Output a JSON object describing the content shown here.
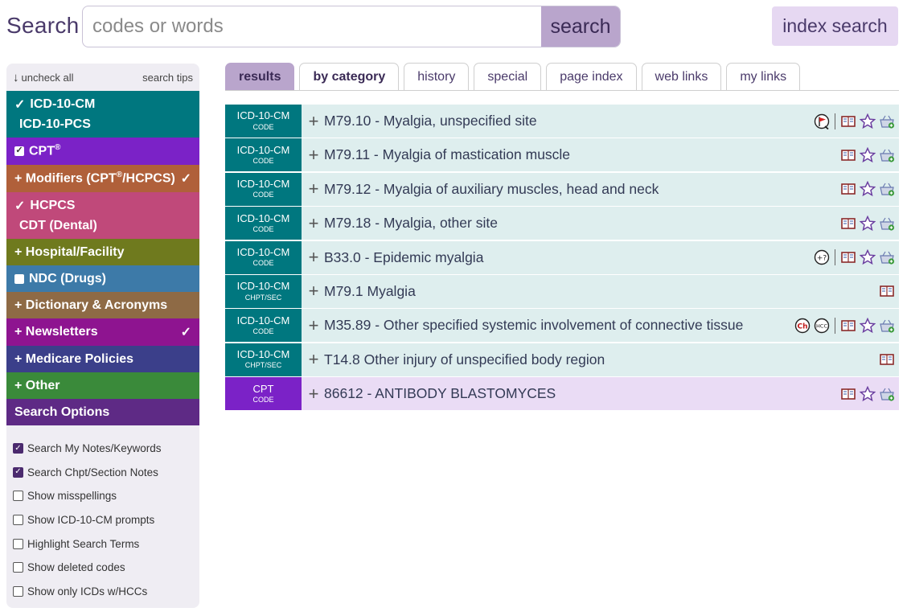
{
  "search": {
    "label": "Search",
    "placeholder": "codes or words",
    "value": "",
    "button": "search",
    "index_button": "index search"
  },
  "sidebar": {
    "uncheck_all": "uncheck all",
    "search_tips": "search tips",
    "categories": {
      "icd10cm": {
        "label": "ICD-10-CM",
        "checked": true,
        "color": "#00777f"
      },
      "icd10pcs": {
        "label": "ICD-10-PCS",
        "checked": false
      },
      "cpt": {
        "label": "CPT",
        "sup": "®",
        "checked": true,
        "color": "#7b22c7"
      },
      "modifiers": {
        "label": "+ Modifiers (CPT",
        "sup": "®",
        "label_tail": "/HCPCS)",
        "check": "✓",
        "color": "#b0603a"
      },
      "hcpcs": {
        "label": "HCPCS",
        "checked": true,
        "color": "#c0497a"
      },
      "cdt": {
        "label": "CDT (Dental)",
        "checked": false
      },
      "hospital": {
        "label": "+ Hospital/Facility",
        "color": "#6f7a1e"
      },
      "ndc": {
        "label": "NDC (Drugs)",
        "checked": false,
        "color": "#3d7aa8"
      },
      "dictionary": {
        "label": "+ Dictionary & Acronyms",
        "color": "#8e6a45"
      },
      "newsletters": {
        "label": "+ Newsletters",
        "check": "✓",
        "color": "#8e1490"
      },
      "medicare": {
        "label": "+ Medicare Policies",
        "color": "#3b3f8a"
      },
      "other": {
        "label": "+ Other",
        "color": "#3a8a3a"
      },
      "search_options": {
        "label": "Search Options",
        "color": "#5e2a85"
      }
    },
    "options": [
      {
        "label": "Search My Notes/Keywords",
        "checked": true
      },
      {
        "label": "Search Chpt/Section Notes",
        "checked": true
      },
      {
        "label": "Show misspellings",
        "checked": false
      },
      {
        "label": "Show ICD-10-CM prompts",
        "checked": false
      },
      {
        "label": "Highlight Search Terms",
        "checked": false
      },
      {
        "label": "Show deleted codes",
        "checked": false
      },
      {
        "label": "Show only ICDs w/HCCs",
        "checked": false
      }
    ]
  },
  "tabs": [
    "results",
    "by category",
    "history",
    "special",
    "page index",
    "web links",
    "my links"
  ],
  "results": [
    {
      "system": "ICD-10-CM",
      "kind": "CODE",
      "text": "M79.10 - Myalgia, unspecified site",
      "icons": [
        "flag-icon",
        "sep",
        "book-icon",
        "star-icon",
        "basket-icon"
      ]
    },
    {
      "system": "ICD-10-CM",
      "kind": "CODE",
      "text": "M79.11 - Myalgia of mastication muscle",
      "icons": [
        "book-icon",
        "star-icon",
        "basket-icon"
      ]
    },
    {
      "system": "ICD-10-CM",
      "kind": "CODE",
      "text": "M79.12 - Myalgia of auxiliary muscles, head and neck",
      "icons": [
        "book-icon",
        "star-icon",
        "basket-icon"
      ]
    },
    {
      "system": "ICD-10-CM",
      "kind": "CODE",
      "text": "M79.18 - Myalgia, other site",
      "icons": [
        "book-icon",
        "star-icon",
        "basket-icon"
      ]
    },
    {
      "system": "ICD-10-CM",
      "kind": "CODE",
      "text": "B33.0 - Epidemic myalgia",
      "icons": [
        "plus-question-icon",
        "sep",
        "book-icon",
        "star-icon",
        "basket-icon"
      ]
    },
    {
      "system": "ICD-10-CM",
      "kind": "CHPT/SEC",
      "text": "M79.1 Myalgia",
      "icons": [
        "book-icon"
      ]
    },
    {
      "system": "ICD-10-CM",
      "kind": "CODE",
      "text": "M35.89 - Other specified systemic involvement of connective tissue",
      "icons": [
        "ch-icon",
        "hcc-icon",
        "sep",
        "book-icon",
        "star-icon",
        "basket-icon"
      ]
    },
    {
      "system": "ICD-10-CM",
      "kind": "CHPT/SEC",
      "text": "T14.8 Other injury of unspecified body region",
      "icons": [
        "book-icon"
      ]
    },
    {
      "system": "CPT",
      "kind": "CODE",
      "text": "86612 - ANTIBODY BLASTOMYCES",
      "icons": [
        "book-icon",
        "star-icon",
        "basket-icon"
      ]
    }
  ],
  "colors": {
    "icd_badge": "#00777f",
    "icd_row": "#deeeee",
    "cpt_badge": "#7b22c7",
    "cpt_row": "#eadcf5",
    "accent": "#b9a5cc"
  }
}
